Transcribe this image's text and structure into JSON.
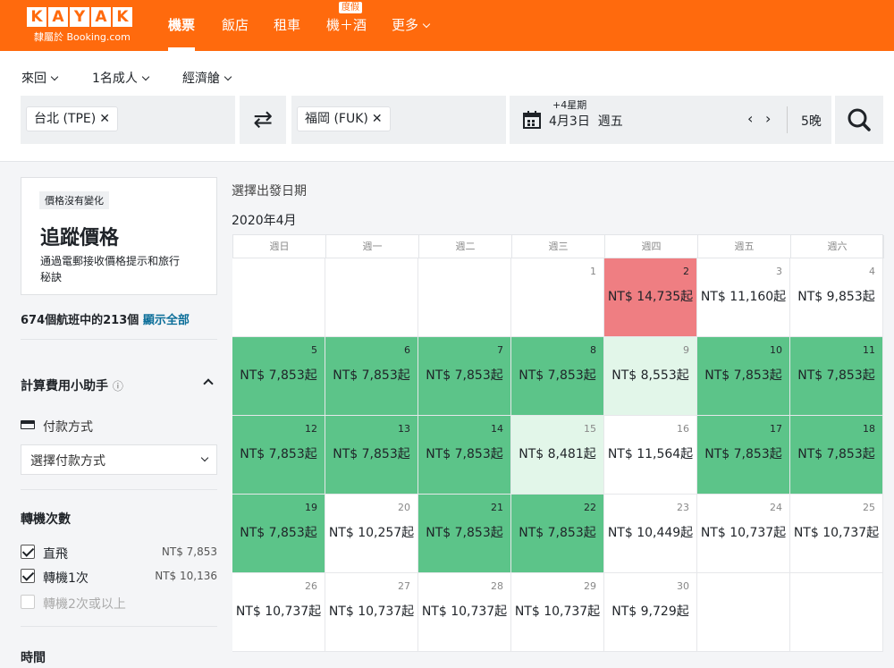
{
  "brand": {
    "logo_letters": [
      "K",
      "A",
      "Y",
      "A",
      "K"
    ],
    "subtitle": "隸屬於 Booking.com"
  },
  "nav": {
    "flights": "機票",
    "hotels": "飯店",
    "cars": "租車",
    "packages": "機＋酒",
    "packages_badge": "度假",
    "more": "更多"
  },
  "options": {
    "trip_type": "來回",
    "travelers": "1名成人",
    "cabin": "經濟艙"
  },
  "search": {
    "origin": "台北 (TPE)",
    "destination": "福岡 (FUK)",
    "flex_note": "+4星期",
    "date": "4月3日",
    "weekday": "週五",
    "nights": "5晚"
  },
  "sidebar": {
    "alert_tag": "價格沒有變化",
    "alert_title": "追蹤價格",
    "alert_desc_line1": "通過電郵接收價格提示和旅行",
    "alert_desc_line2": "秘訣",
    "count_text": "674個航班中的213個",
    "show_all": "顯示全部",
    "fee_helper": "計算費用小助手",
    "payment_label": "付款方式",
    "payment_select": "選擇付款方式",
    "stops_title": "轉機次數",
    "stops": [
      {
        "label": "直飛",
        "price": "NT$ 7,853",
        "checked": true
      },
      {
        "label": "轉機1次",
        "price": "NT$ 10,136",
        "checked": true
      },
      {
        "label": "轉機2次或以上",
        "price": "",
        "checked": false
      }
    ],
    "time_title": "時間"
  },
  "calendar": {
    "prompt": "選擇出發日期",
    "month": "2020年4月",
    "weekdays": [
      "週日",
      "週一",
      "週二",
      "週三",
      "週四",
      "週五",
      "週六"
    ],
    "colors": {
      "cheap": "#5cc489",
      "mid": "#e2f6e9",
      "expensive": "#ef7e82"
    },
    "cells": [
      {
        "day": "",
        "price": "",
        "level": ""
      },
      {
        "day": "",
        "price": "",
        "level": ""
      },
      {
        "day": "",
        "price": "",
        "level": ""
      },
      {
        "day": "1",
        "price": "",
        "level": ""
      },
      {
        "day": "2",
        "price": "NT$ 14,735起",
        "level": "r"
      },
      {
        "day": "3",
        "price": "NT$ 11,160起",
        "level": ""
      },
      {
        "day": "4",
        "price": "NT$ 9,853起",
        "level": ""
      },
      {
        "day": "5",
        "price": "NT$ 7,853起",
        "level": "g"
      },
      {
        "day": "6",
        "price": "NT$ 7,853起",
        "level": "g"
      },
      {
        "day": "7",
        "price": "NT$ 7,853起",
        "level": "g"
      },
      {
        "day": "8",
        "price": "NT$ 7,853起",
        "level": "g"
      },
      {
        "day": "9",
        "price": "NT$ 8,553起",
        "level": "lg"
      },
      {
        "day": "10",
        "price": "NT$ 7,853起",
        "level": "g"
      },
      {
        "day": "11",
        "price": "NT$ 7,853起",
        "level": "g"
      },
      {
        "day": "12",
        "price": "NT$ 7,853起",
        "level": "g"
      },
      {
        "day": "13",
        "price": "NT$ 7,853起",
        "level": "g"
      },
      {
        "day": "14",
        "price": "NT$ 7,853起",
        "level": "g"
      },
      {
        "day": "15",
        "price": "NT$ 8,481起",
        "level": "lg"
      },
      {
        "day": "16",
        "price": "NT$ 11,564起",
        "level": ""
      },
      {
        "day": "17",
        "price": "NT$ 7,853起",
        "level": "g"
      },
      {
        "day": "18",
        "price": "NT$ 7,853起",
        "level": "g"
      },
      {
        "day": "19",
        "price": "NT$ 7,853起",
        "level": "g"
      },
      {
        "day": "20",
        "price": "NT$ 10,257起",
        "level": ""
      },
      {
        "day": "21",
        "price": "NT$ 7,853起",
        "level": "g"
      },
      {
        "day": "22",
        "price": "NT$ 7,853起",
        "level": "g"
      },
      {
        "day": "23",
        "price": "NT$ 10,449起",
        "level": ""
      },
      {
        "day": "24",
        "price": "NT$ 10,737起",
        "level": ""
      },
      {
        "day": "25",
        "price": "NT$ 10,737起",
        "level": ""
      },
      {
        "day": "26",
        "price": "NT$ 10,737起",
        "level": ""
      },
      {
        "day": "27",
        "price": "NT$ 10,737起",
        "level": ""
      },
      {
        "day": "28",
        "price": "NT$ 10,737起",
        "level": ""
      },
      {
        "day": "29",
        "price": "NT$ 10,737起",
        "level": ""
      },
      {
        "day": "30",
        "price": "NT$ 9,729起",
        "level": ""
      },
      {
        "day": "",
        "price": "",
        "level": ""
      },
      {
        "day": "",
        "price": "",
        "level": ""
      }
    ]
  }
}
